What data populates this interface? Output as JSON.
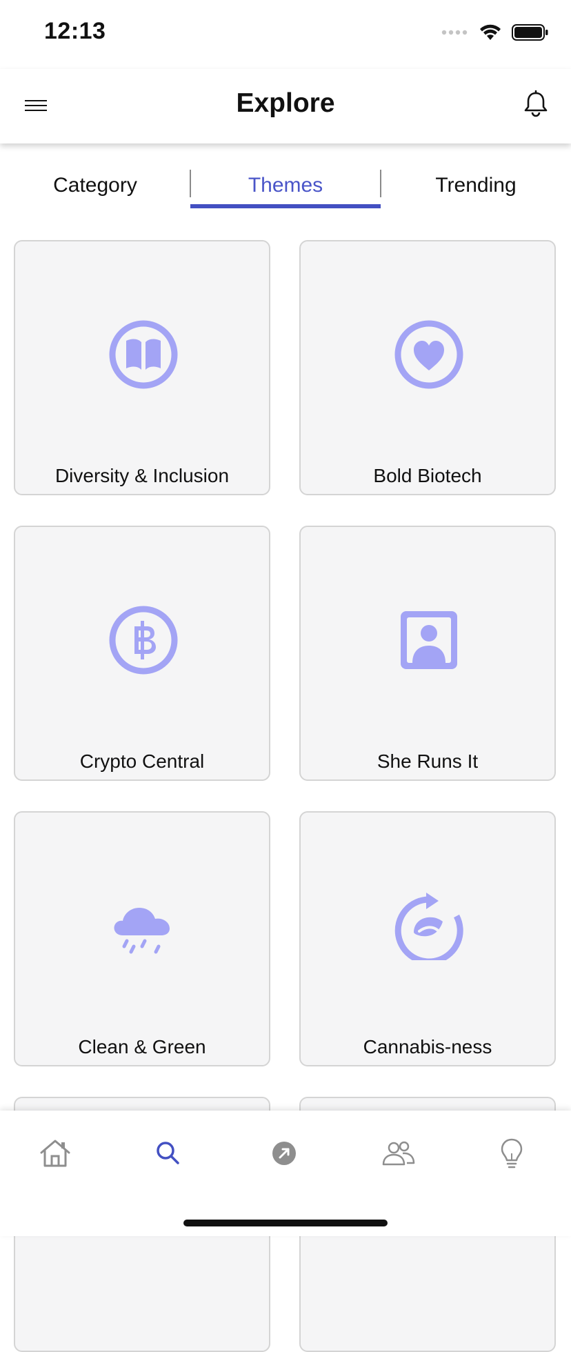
{
  "status_bar": {
    "time": "12:13"
  },
  "header": {
    "title": "Explore"
  },
  "tabs": [
    {
      "label": "Category",
      "active": false
    },
    {
      "label": "Themes",
      "active": true
    },
    {
      "label": "Trending",
      "active": false
    }
  ],
  "themes": [
    {
      "label": "Diversity & Inclusion",
      "icon": "book-icon"
    },
    {
      "label": "Bold Biotech",
      "icon": "heart-icon"
    },
    {
      "label": "Crypto Central",
      "icon": "baht-coin-icon"
    },
    {
      "label": "She Runs It",
      "icon": "person-portrait-icon"
    },
    {
      "label": "Clean & Green",
      "icon": "cloud-rain-icon"
    },
    {
      "label": "Cannabis-ness",
      "icon": "leaf-cycle-icon"
    }
  ],
  "bottom_nav": [
    {
      "icon": "home-icon",
      "active": false
    },
    {
      "icon": "search-icon",
      "active": true
    },
    {
      "icon": "arrow-up-right-icon",
      "active": false
    },
    {
      "icon": "people-icon",
      "active": false
    },
    {
      "icon": "lightbulb-icon",
      "active": false
    }
  ],
  "colors": {
    "accent": "#4350c2",
    "icon": "#a3a4f5",
    "card_bg": "#f5f5f6",
    "nav_icon": "#8e8e8e"
  }
}
